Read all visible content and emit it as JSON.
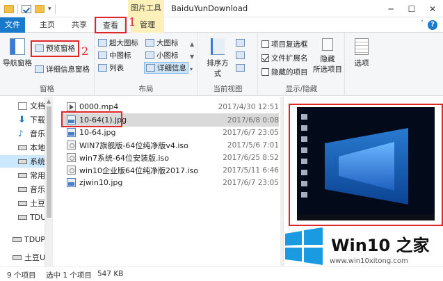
{
  "window": {
    "title": "BaiduYunDownload",
    "tool_tab_header": "图片工具"
  },
  "tabs": {
    "file": "文件",
    "home": "主页",
    "share": "共享",
    "view": "查看",
    "manage": "管理",
    "help": "?"
  },
  "annotations": {
    "one": "1",
    "two": "2"
  },
  "ribbon": {
    "panes": {
      "label": "窗格",
      "nav_pane": "导航窗格",
      "preview_pane": "预览窗格",
      "details_pane": "详细信息窗格"
    },
    "layout": {
      "label": "布局",
      "items": [
        "超大图标",
        "大图标",
        "中图标",
        "小图标",
        "列表",
        "详细信息"
      ]
    },
    "current_view": {
      "label": "当前视图",
      "sort_by": "排序方式"
    },
    "show_hide": {
      "label": "显示/隐藏",
      "item_checkboxes": "项目复选框",
      "file_extensions": "文件扩展名",
      "hidden_items": "隐藏的项目",
      "hide_selected_1": "隐藏",
      "hide_selected_2": "所选项目",
      "options": "选项"
    }
  },
  "nav": {
    "items": [
      "文档",
      "下载",
      "音乐",
      "本地",
      "系统",
      "常用",
      "音乐",
      "土豆",
      "TDU",
      "TDUP",
      "土豆U"
    ]
  },
  "files": [
    {
      "name": "0000.mp4",
      "date": "2017/4/30 12:51",
      "type": "vid"
    },
    {
      "name": "10-64(1).jpg",
      "date": "2017/6/8 0:08",
      "type": "img"
    },
    {
      "name": "10-64.jpg",
      "date": "2017/6/7 23:05",
      "type": "img"
    },
    {
      "name": "WIN7旗舰版-64位纯净版v4.iso",
      "date": "2017/5/6 7:01",
      "type": "iso"
    },
    {
      "name": "win7系统-64位安装版.iso",
      "date": "2017/6/25 8:52",
      "type": "iso"
    },
    {
      "name": "win10企业版64位纯净版2017.iso",
      "date": "2017/5/11 6:46",
      "type": "iso"
    },
    {
      "name": "zjwin10.jpg",
      "date": "2017/6/7 23:05",
      "type": "img"
    }
  ],
  "selected_file_index": 1,
  "watermark": {
    "brand": "Win10 之家",
    "url": "www.win10xitong.com"
  },
  "status": {
    "item_count": "9 个项目",
    "selected": "选中 1 个项目",
    "size": "547 KB"
  },
  "colors": {
    "accent": "#1979ca",
    "annotation_red": "#e0262b",
    "tool_tab": "#fdf0b8"
  }
}
